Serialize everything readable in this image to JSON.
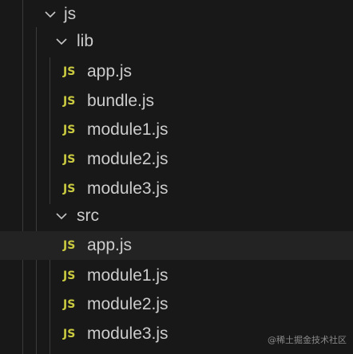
{
  "explorer": {
    "folders": {
      "js": "js",
      "lib": "lib",
      "src": "src"
    },
    "lib_files": [
      "app.js",
      "bundle.js",
      "module1.js",
      "module2.js",
      "module3.js"
    ],
    "src_files": [
      "app.js",
      "module1.js",
      "module2.js",
      "module3.js"
    ],
    "file_icon_text": "JS",
    "icon_color": "#cbcb41"
  },
  "watermark": "@稀土掘金技术社区"
}
